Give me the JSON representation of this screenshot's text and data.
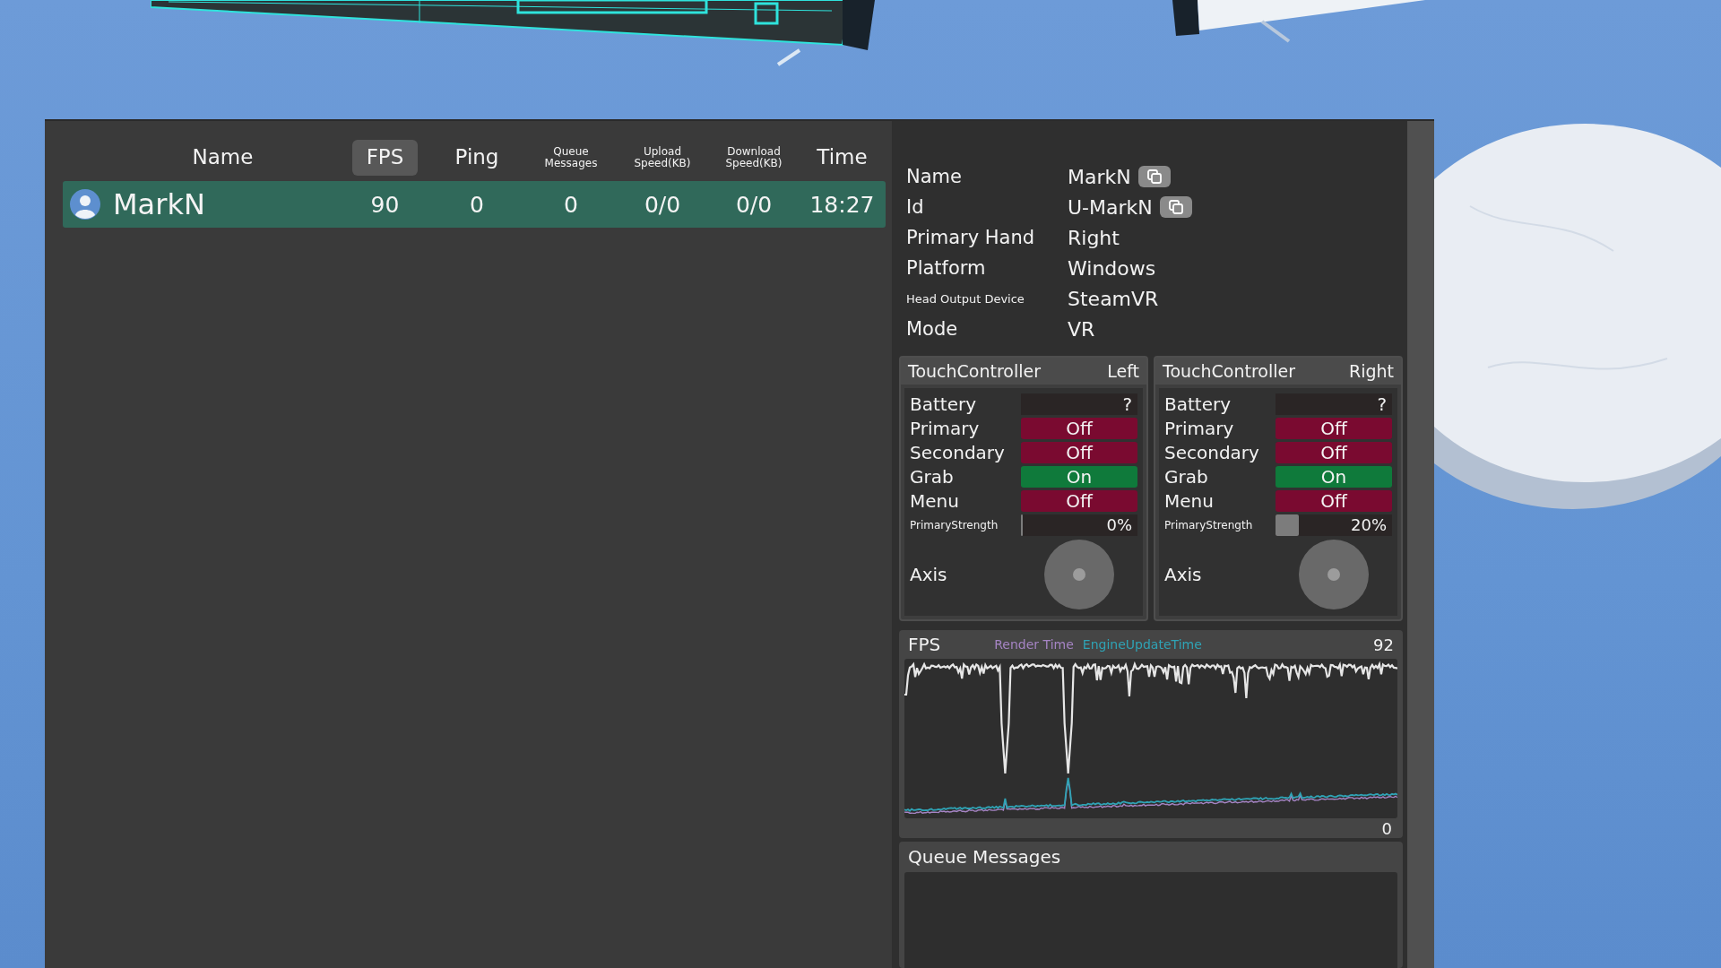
{
  "player_table": {
    "columns": [
      {
        "label": "Name",
        "kind": "plain",
        "selected": false
      },
      {
        "label": "FPS",
        "kind": "plain",
        "selected": true
      },
      {
        "label": "Ping",
        "kind": "plain",
        "selected": false
      },
      {
        "label": "Queue Messages",
        "kind": "compact",
        "selected": false
      },
      {
        "label": "Upload Speed(KB)",
        "kind": "compact",
        "selected": false
      },
      {
        "label": "Download Speed(KB)",
        "kind": "compact",
        "selected": false
      },
      {
        "label": "Time",
        "kind": "plain",
        "selected": false
      }
    ],
    "rows": [
      {
        "name": "MarkN",
        "selected": true,
        "values": [
          "90",
          "0",
          "0",
          "0/0",
          "0/0",
          "18:27"
        ]
      }
    ]
  },
  "user_info": [
    {
      "label": "Name",
      "value": "MarkN",
      "kind": "plain",
      "copy_button": true
    },
    {
      "label": "Id",
      "value": "U-MarkN",
      "kind": "plain",
      "copy_button": true
    },
    {
      "label": "Primary Hand",
      "value": "Right",
      "kind": "plain",
      "copy_button": false
    },
    {
      "label": "Platform",
      "value": "Windows",
      "kind": "plain",
      "copy_button": false
    },
    {
      "label": "Head Output Device",
      "value": "SteamVR",
      "kind": "compact",
      "copy_button": false
    },
    {
      "label": "Mode",
      "value": "VR",
      "kind": "plain",
      "copy_button": false
    }
  ],
  "controllers": [
    {
      "title": "TouchController",
      "side": "Left",
      "battery": {
        "label": "Battery",
        "value": "?"
      },
      "buttons": [
        {
          "label": "Primary",
          "value": "Off",
          "on": false
        },
        {
          "label": "Secondary",
          "value": "Off",
          "on": false
        },
        {
          "label": "Grab",
          "value": "On",
          "on": true
        },
        {
          "label": "Menu",
          "value": "Off",
          "on": false
        }
      ],
      "strength": {
        "label": "PrimaryStrength",
        "level": 0,
        "reading": "0%"
      },
      "axis": {
        "label": "Axis"
      }
    },
    {
      "title": "TouchController",
      "side": "Right",
      "battery": {
        "label": "Battery",
        "value": "?"
      },
      "buttons": [
        {
          "label": "Primary",
          "value": "Off",
          "on": false
        },
        {
          "label": "Secondary",
          "value": "Off",
          "on": false
        },
        {
          "label": "Grab",
          "value": "On",
          "on": true
        },
        {
          "label": "Menu",
          "value": "Off",
          "on": false
        }
      ],
      "strength": {
        "label": "PrimaryStrength",
        "level": 0.2,
        "reading": "20%"
      },
      "axis": {
        "label": "Axis"
      }
    }
  ],
  "performance_graph": {
    "title": "FPS",
    "legend": [
      {
        "label": "Render Time",
        "color": "#a584c4"
      },
      {
        "label": "EngineUpdateTime",
        "color": "#2fa3b5"
      }
    ],
    "max": "92",
    "min": "0"
  },
  "queue_messages": {
    "title": "Queue Messages"
  }
}
